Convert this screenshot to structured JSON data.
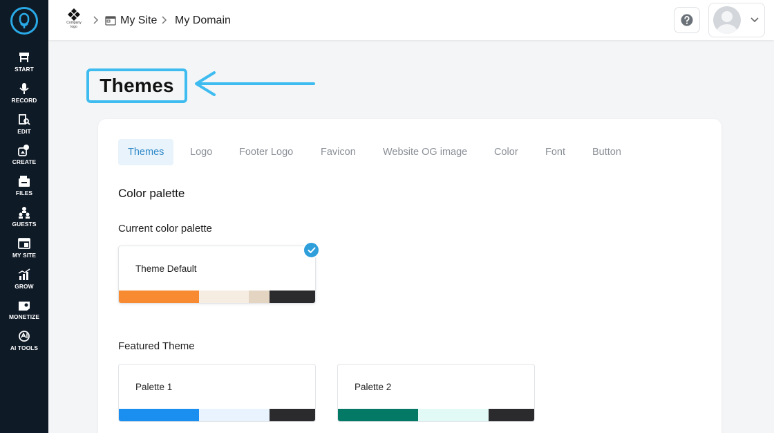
{
  "sidebar": {
    "items": [
      {
        "label": "START",
        "icon": "start-icon"
      },
      {
        "label": "RECORD",
        "icon": "microphone-icon"
      },
      {
        "label": "EDIT",
        "icon": "edit-icon"
      },
      {
        "label": "CREATE",
        "icon": "create-icon"
      },
      {
        "label": "FILES",
        "icon": "files-icon"
      },
      {
        "label": "GUESTS",
        "icon": "guests-icon"
      },
      {
        "label": "MY SITE",
        "icon": "my-site-icon"
      },
      {
        "label": "GROW",
        "icon": "grow-icon"
      },
      {
        "label": "MONETIZE",
        "icon": "monetize-icon"
      },
      {
        "label": "AI TOOLS",
        "icon": "ai-tools-icon"
      }
    ]
  },
  "topbar": {
    "logo_text_1": "Company",
    "logo_text_2": "logo",
    "breadcrumb": [
      "My Site",
      "My Domain"
    ]
  },
  "page": {
    "title": "Themes"
  },
  "tabs": [
    "Themes",
    "Logo",
    "Footer Logo",
    "Favicon",
    "Website OG image",
    "Color",
    "Font",
    "Button"
  ],
  "content": {
    "section_title": "Color palette",
    "current_label": "Current color palette",
    "featured_label": "Featured Theme"
  },
  "palettes": {
    "current": {
      "name": "Theme Default",
      "colors": [
        "#f88a32",
        "#f5ece2",
        "#e4d5c3",
        "#2b2b2d"
      ]
    },
    "featured": [
      {
        "name": "Palette 1",
        "colors": [
          "#1a8ff0",
          "#e9f3fd",
          "#2b2b2d"
        ]
      },
      {
        "name": "Palette 2",
        "colors": [
          "#047a66",
          "#e2faf5",
          "#2b2b2d"
        ]
      }
    ]
  },
  "colors": {
    "accent": "#3ebcf0",
    "sidebar_bg": "#0f1a27",
    "tab_active_text": "#2e89c8",
    "check": "#2f9fdc"
  }
}
